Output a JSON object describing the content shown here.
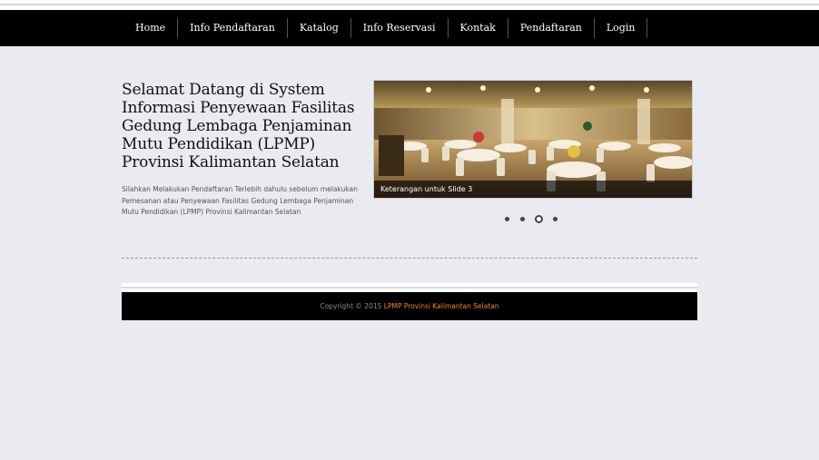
{
  "nav": {
    "items": [
      {
        "label": "Home"
      },
      {
        "label": "Info Pendaftaran"
      },
      {
        "label": "Katalog"
      },
      {
        "label": "Info Reservasi"
      },
      {
        "label": "Kontak"
      },
      {
        "label": "Pendaftaran"
      },
      {
        "label": "Login"
      }
    ]
  },
  "main": {
    "headline": "Selamat Datang di System Informasi Penyewaan Fasilitas Gedung Lembaga Penjaminan Mutu Pendidikan (LPMP) Provinsi Kalimantan Selatan",
    "intro": "Silahkan Melakukan Pendaftaran Terlebih dahulu sebelum melakukan Pemesanan atau Penyewaan Fasilitas Gedung Lembaga Penjaminan Mutu Pendidikan (LPMP) Provinsi Kalimantan Selatan"
  },
  "slider": {
    "caption": "Keterangan untuk Slide 3",
    "slide_count": 4,
    "active_slide": 3,
    "image_icon": "banquet-hall-photo"
  },
  "footer": {
    "copyright_prefix": "Copyright © 2015",
    "brand": "LPMP Provinsi Kalimantan Selatan"
  },
  "colors": {
    "page_bg": "#eaebf0",
    "nav_bg": "#000000",
    "footer_brand": "#f08a1c"
  }
}
